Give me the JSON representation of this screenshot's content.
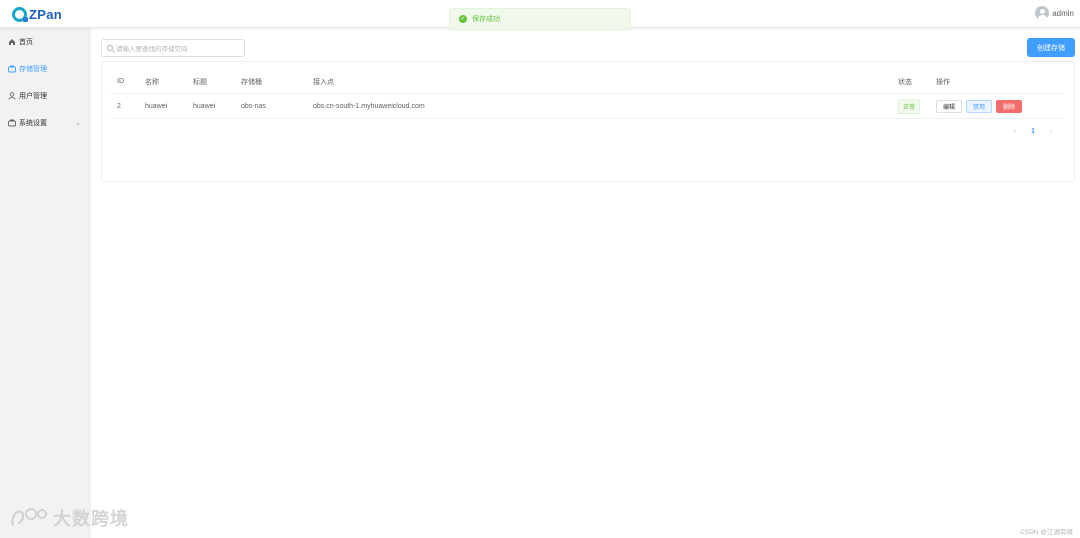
{
  "header": {
    "app_name": "ZPan",
    "username": "admin"
  },
  "toast": {
    "message": "保存成功"
  },
  "sidebar": {
    "items": [
      {
        "label": "首页",
        "icon": "home-icon",
        "active": false
      },
      {
        "label": "存储管理",
        "icon": "storage-icon",
        "active": true
      },
      {
        "label": "用户管理",
        "icon": "user-icon",
        "active": false
      },
      {
        "label": "系统设置",
        "icon": "settings-icon",
        "active": false,
        "expandable": true
      }
    ]
  },
  "toolbar": {
    "search_placeholder": "请输入要查找的存储空间",
    "create_label": "创建存储"
  },
  "table": {
    "columns": [
      "ID",
      "名称",
      "标题",
      "存储桶",
      "接入点",
      "状态",
      "操作"
    ],
    "rows": [
      {
        "id": "2",
        "name": "huawei",
        "title": "huawei",
        "bucket": "obs-nas",
        "endpoint": "obs.cn-south-1.myhuaweicloud.com",
        "status": "正常",
        "actions": {
          "edit": "编辑",
          "disable": "禁用",
          "delete": "删除"
        }
      }
    ]
  },
  "pagination": {
    "prev": "‹",
    "current": "1",
    "next": "›"
  },
  "watermark": {
    "text": "大数跨境"
  },
  "credit": "CSDN @江湖有缘",
  "colors": {
    "primary": "#409eff",
    "success": "#67c23a",
    "danger": "#f56c6c",
    "sidebar_bg": "#f2f2f2"
  }
}
